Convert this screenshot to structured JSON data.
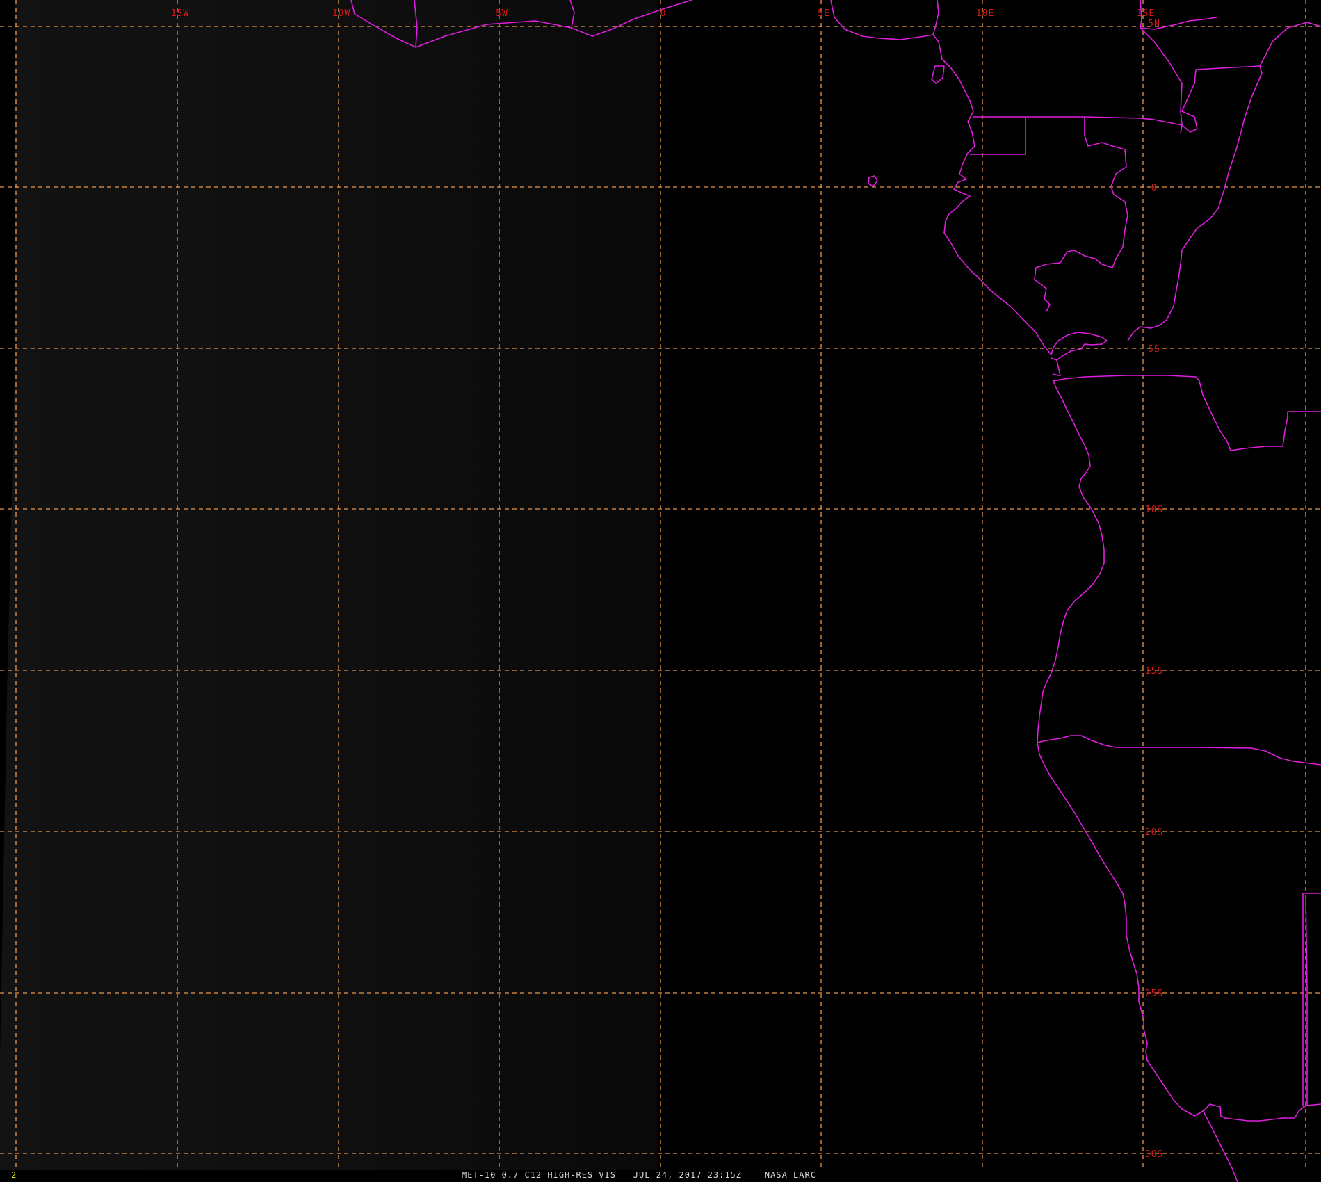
{
  "colors": {
    "background": "#000000",
    "dark_haze": "#111111",
    "grid_line": "#e8964a",
    "coastline": "#e01ee0",
    "grid_label": "#d81818",
    "caption_text": "#d8d8d8",
    "frame_number": "#e8e800"
  },
  "grid": {
    "lon_labels": [
      "15W",
      "10W",
      "5W",
      "0",
      "5E",
      "10E",
      "15E"
    ],
    "lat_labels": [
      "5N",
      "0",
      "5S",
      "10S",
      "15S",
      "20S",
      "25S",
      "30S"
    ]
  },
  "footer": {
    "frame_number": "2",
    "caption": "MET-10 0.7 C12 HIGH-RES VIS   JUL 24, 2017 23:15Z    NASA LARC"
  }
}
